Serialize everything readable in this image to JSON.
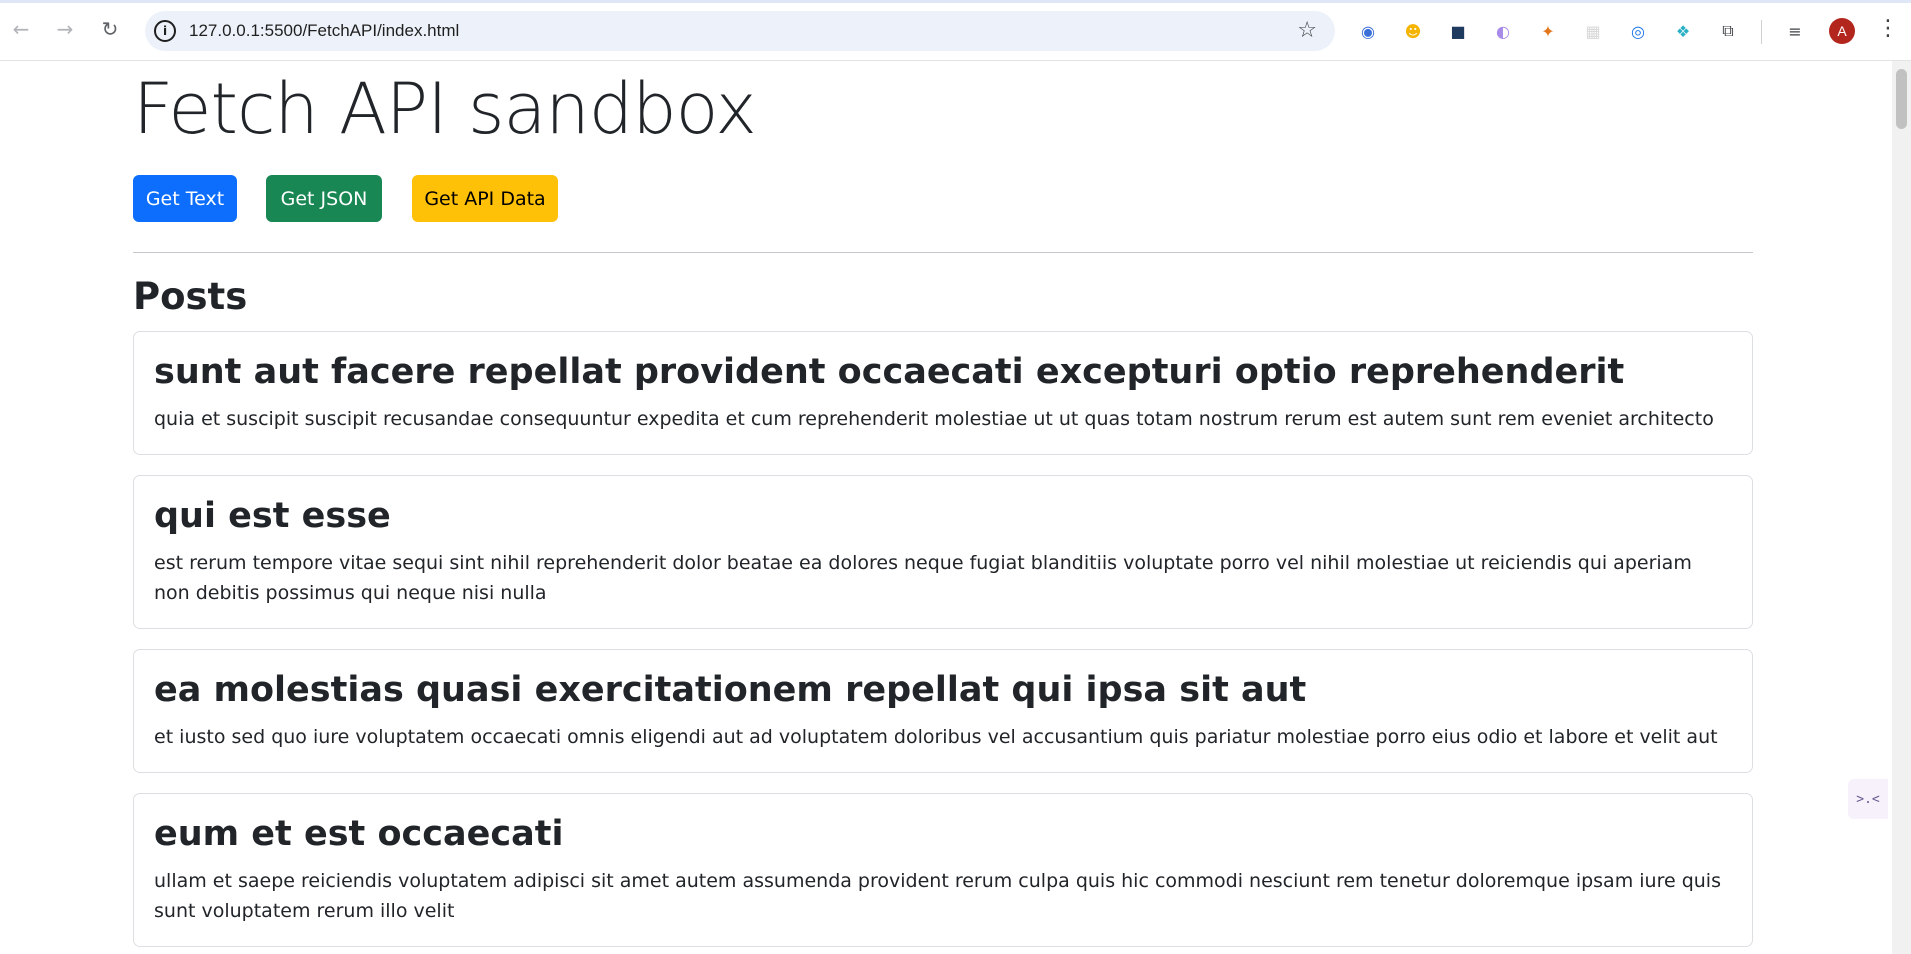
{
  "browser": {
    "back_icon": "←",
    "forward_icon": "→",
    "reload_icon": "↻",
    "site_info_icon": "i",
    "url": "127.0.0.1:5500/FetchAPI/index.html",
    "bookmark_icon": "☆",
    "extensions": [
      {
        "name": "extension-1-icon",
        "glyph": "◉",
        "color": "#3b6fd8"
      },
      {
        "name": "extension-2-icon",
        "glyph": "☻",
        "color": "#f4b400"
      },
      {
        "name": "extension-3-icon",
        "glyph": "■",
        "color": "#1f3a5f"
      },
      {
        "name": "extension-4-icon",
        "glyph": "◐",
        "color": "#a88be8"
      },
      {
        "name": "metamask-icon",
        "glyph": "✦",
        "color": "#e2761b"
      },
      {
        "name": "extension-6-icon",
        "glyph": "▦",
        "color": "#d7d7d7"
      },
      {
        "name": "extension-7-icon",
        "glyph": "◎",
        "color": "#1a73e8"
      },
      {
        "name": "extension-8-icon",
        "glyph": "❖",
        "color": "#2ab0c5"
      },
      {
        "name": "puzzle-icon",
        "glyph": "⧉",
        "color": "#3c4043"
      },
      {
        "name": "media-controls-icon",
        "glyph": "≡",
        "color": "#3c4043"
      }
    ],
    "avatar_initial": "A",
    "menu_icon": "⋮"
  },
  "page": {
    "title": "Fetch API sandbox",
    "buttons": {
      "get_text": "Get Text",
      "get_json": "Get JSON",
      "get_api_data": "Get API Data"
    },
    "posts_heading": "Posts",
    "posts": [
      {
        "title": "sunt aut facere repellat provident occaecati excepturi optio reprehenderit",
        "body": "quia et suscipit suscipit recusandae consequuntur expedita et cum reprehenderit molestiae ut ut quas totam nostrum rerum est autem sunt rem eveniet architecto"
      },
      {
        "title": "qui est esse",
        "body": "est rerum tempore vitae sequi sint nihil reprehenderit dolor beatae ea dolores neque fugiat blanditiis voluptate porro vel nihil molestiae ut reiciendis qui aperiam non debitis possimus qui neque nisi nulla"
      },
      {
        "title": "ea molestias quasi exercitationem repellat qui ipsa sit aut",
        "body": "et iusto sed quo iure voluptatem occaecati omnis eligendi aut ad voluptatem doloribus vel accusantium quis pariatur molestiae porro eius odio et labore et velit aut"
      },
      {
        "title": "eum et est occaecati",
        "body": "ullam et saepe reiciendis voluptatem adipisci sit amet autem assumenda provident rerum culpa quis hic commodi nesciunt rem tenetur doloremque ipsam iure quis sunt voluptatem rerum illo velit"
      }
    ]
  },
  "side_widget": {
    "glyph": ">.<"
  }
}
